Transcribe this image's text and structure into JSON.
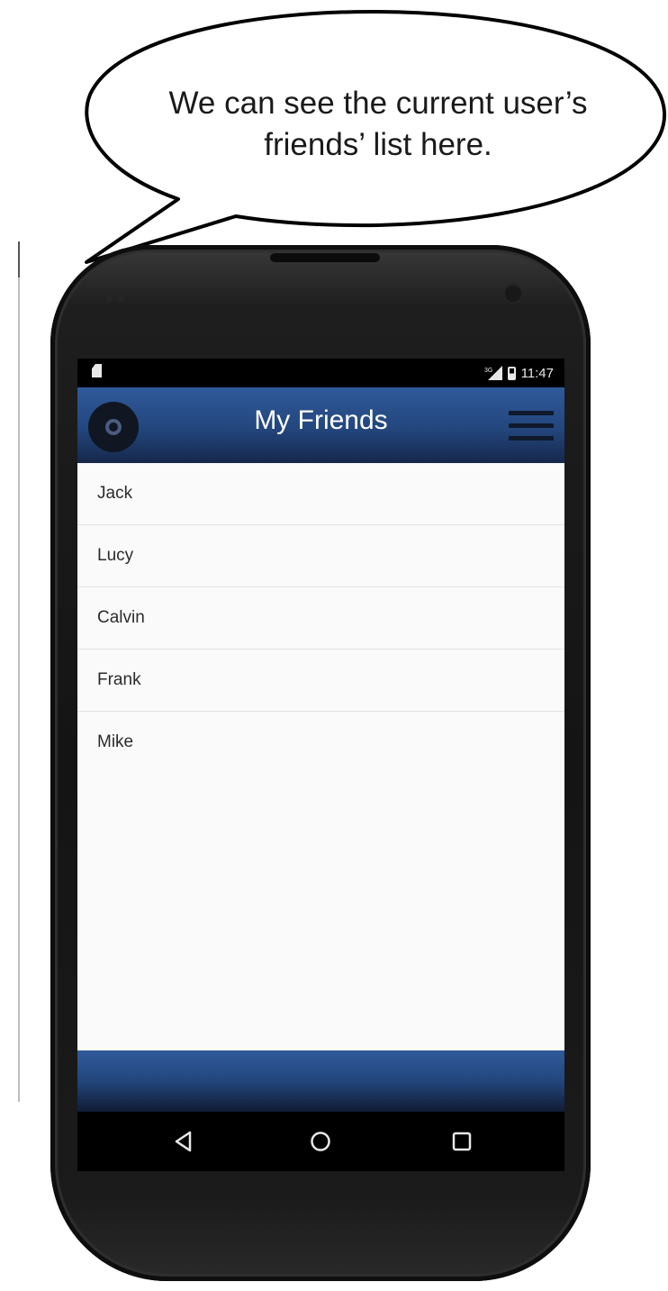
{
  "callout": {
    "line1": "We can see the current user’s",
    "line2": "friends’ list here."
  },
  "status_bar": {
    "time": "11:47",
    "icons": [
      "sd-card-icon",
      "signal-icon",
      "battery-icon"
    ]
  },
  "app_bar": {
    "title": "My Friends",
    "logo_icon": "vinyl-disc-icon",
    "menu_icon": "hamburger-menu-icon"
  },
  "friends": [
    {
      "name": "Jack"
    },
    {
      "name": "Lucy"
    },
    {
      "name": "Calvin"
    },
    {
      "name": "Frank"
    },
    {
      "name": "Mike"
    }
  ],
  "nav_bar": {
    "icons": [
      "back-icon",
      "home-icon",
      "recents-icon"
    ]
  },
  "colors": {
    "app_bar": "#23467d",
    "list_background": "#fafafa",
    "divider": "#e2e2e2"
  }
}
